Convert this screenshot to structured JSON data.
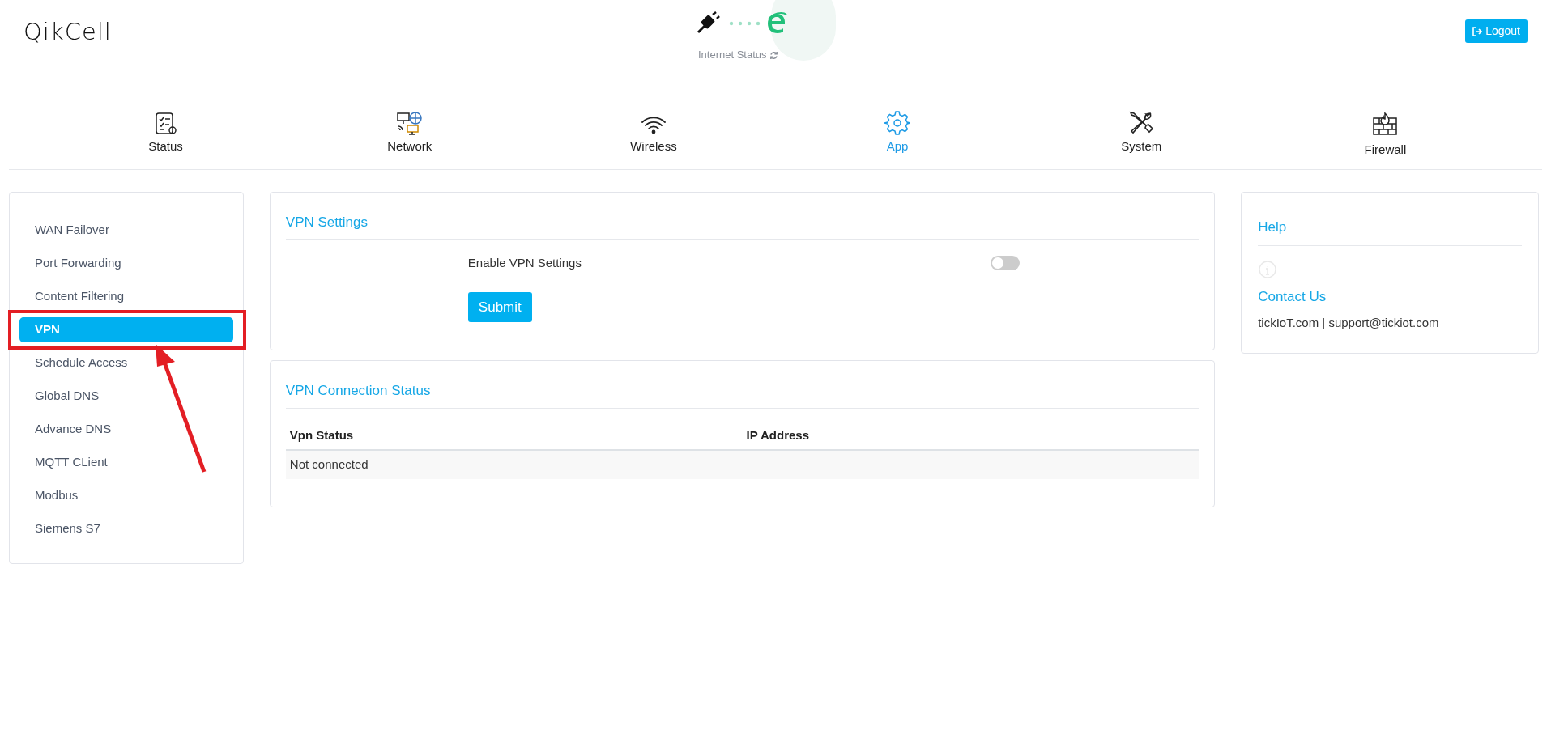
{
  "header": {
    "logo": "QikCell",
    "internet_status": {
      "label": "Internet Status",
      "connected": true
    },
    "logout": "Logout"
  },
  "tabs": [
    {
      "label": "Status",
      "kind": "checklist",
      "selected": false
    },
    {
      "label": "Network",
      "kind": "network",
      "selected": false
    },
    {
      "label": "Wireless",
      "kind": "wifi",
      "selected": false
    },
    {
      "label": "App",
      "kind": "gear",
      "selected": true
    },
    {
      "label": "System",
      "kind": "tools",
      "selected": false
    },
    {
      "label": "Firewall",
      "kind": "firewall",
      "selected": false
    }
  ],
  "sidebar": {
    "items": [
      {
        "label": "WAN Failover",
        "selected": false
      },
      {
        "label": "Port Forwarding",
        "selected": false
      },
      {
        "label": "Content Filtering",
        "selected": false
      },
      {
        "label": "VPN",
        "selected": true
      },
      {
        "label": "Schedule Access",
        "selected": false
      },
      {
        "label": "Global DNS",
        "selected": false
      },
      {
        "label": "Advance DNS",
        "selected": false
      },
      {
        "label": "MQTT CLient",
        "selected": false
      },
      {
        "label": "Modbus",
        "selected": false
      },
      {
        "label": "Siemens S7",
        "selected": false
      }
    ]
  },
  "vpn_settings": {
    "title": "VPN Settings",
    "toggle_label": "Enable VPN Settings",
    "on": false,
    "submit": "Submit"
  },
  "vpn_status": {
    "title": "VPN Connection Status",
    "columns": [
      "Vpn Status",
      "IP Address"
    ],
    "rows": [
      [
        "Not connected",
        null
      ]
    ]
  },
  "help": {
    "title": "Help",
    "contact_title": "Contact Us",
    "contact_text": "tickIoT.com | support@tickiot.com"
  },
  "highlight_frame": {
    "color": "#e31e24"
  },
  "pointer_arrow": {
    "color": "#e31e24"
  }
}
